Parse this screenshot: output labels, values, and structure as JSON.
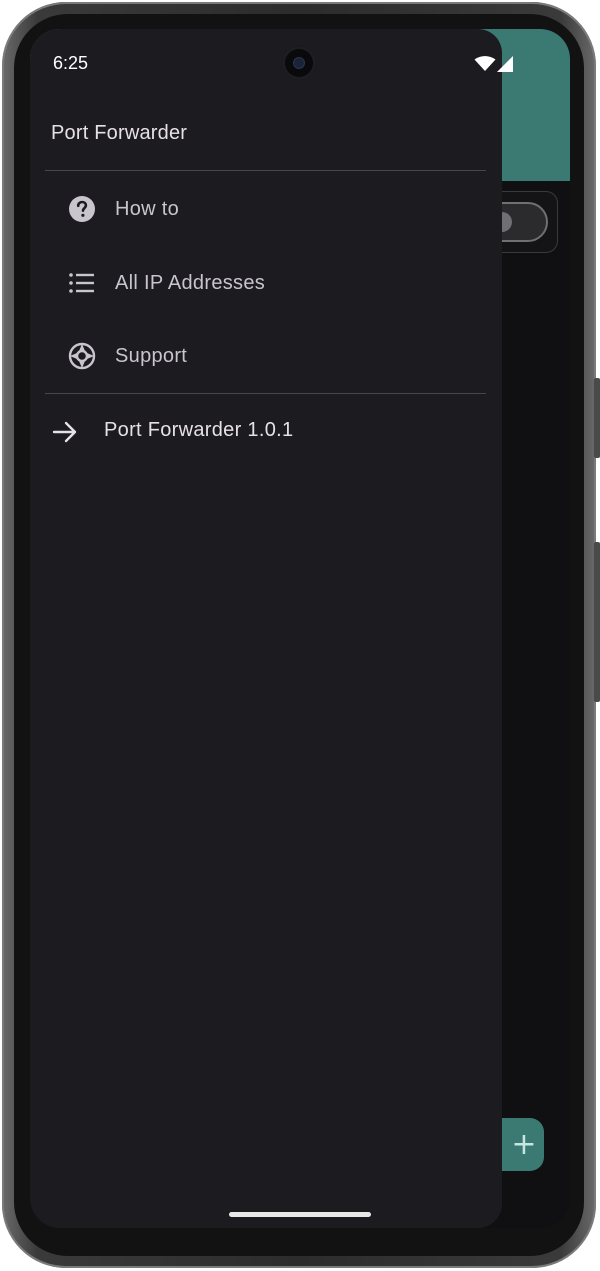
{
  "status_bar": {
    "time": "6:25",
    "icons": [
      "wifi-icon",
      "cellular-signal-icon"
    ]
  },
  "drawer": {
    "title": "Port Forwarder",
    "items": [
      {
        "label": "How to",
        "icon": "help-circle-icon"
      },
      {
        "label": "All IP Addresses",
        "icon": "list-icon"
      },
      {
        "label": "Support",
        "icon": "lifebuoy-icon"
      }
    ],
    "version": {
      "label": "Port Forwarder 1.0.1",
      "icon": "arrow-right-icon"
    }
  },
  "background_app": {
    "fab_label": "+"
  },
  "colors": {
    "drawer_bg": "#1c1b20",
    "accent": "#3a7a72",
    "text_primary": "#e6e1e6",
    "text_secondary": "#c9c5cc"
  }
}
